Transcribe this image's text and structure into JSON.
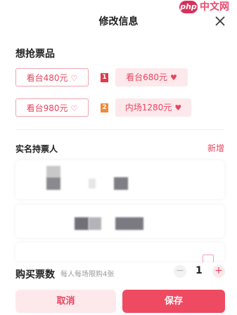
{
  "header": {
    "title": "修改信息",
    "close_icon": "close-icon"
  },
  "watermark": {
    "brand": "php",
    "text": "中文网"
  },
  "tickets": {
    "title": "想抢票品",
    "options": [
      {
        "label": "看台480元",
        "selected": false,
        "rank": ""
      },
      {
        "label": "看台680元",
        "selected": true,
        "rank": "1"
      },
      {
        "label": "看台980元",
        "selected": false,
        "rank": ""
      },
      {
        "label": "内场1280元",
        "selected": true,
        "rank": "2"
      }
    ]
  },
  "holders": {
    "title": "实名持票人",
    "add_label": "新增"
  },
  "quantity": {
    "label": "购买票数",
    "hint": "每人每场限购4张",
    "value": "1",
    "minus": "−",
    "plus": "+"
  },
  "actions": {
    "cancel": "取消",
    "save": "保存"
  },
  "colors": {
    "accent": "#e8455e",
    "accent_light": "#fde9ec",
    "badge1": "#e03b4e",
    "badge2": "#f08a3a"
  }
}
